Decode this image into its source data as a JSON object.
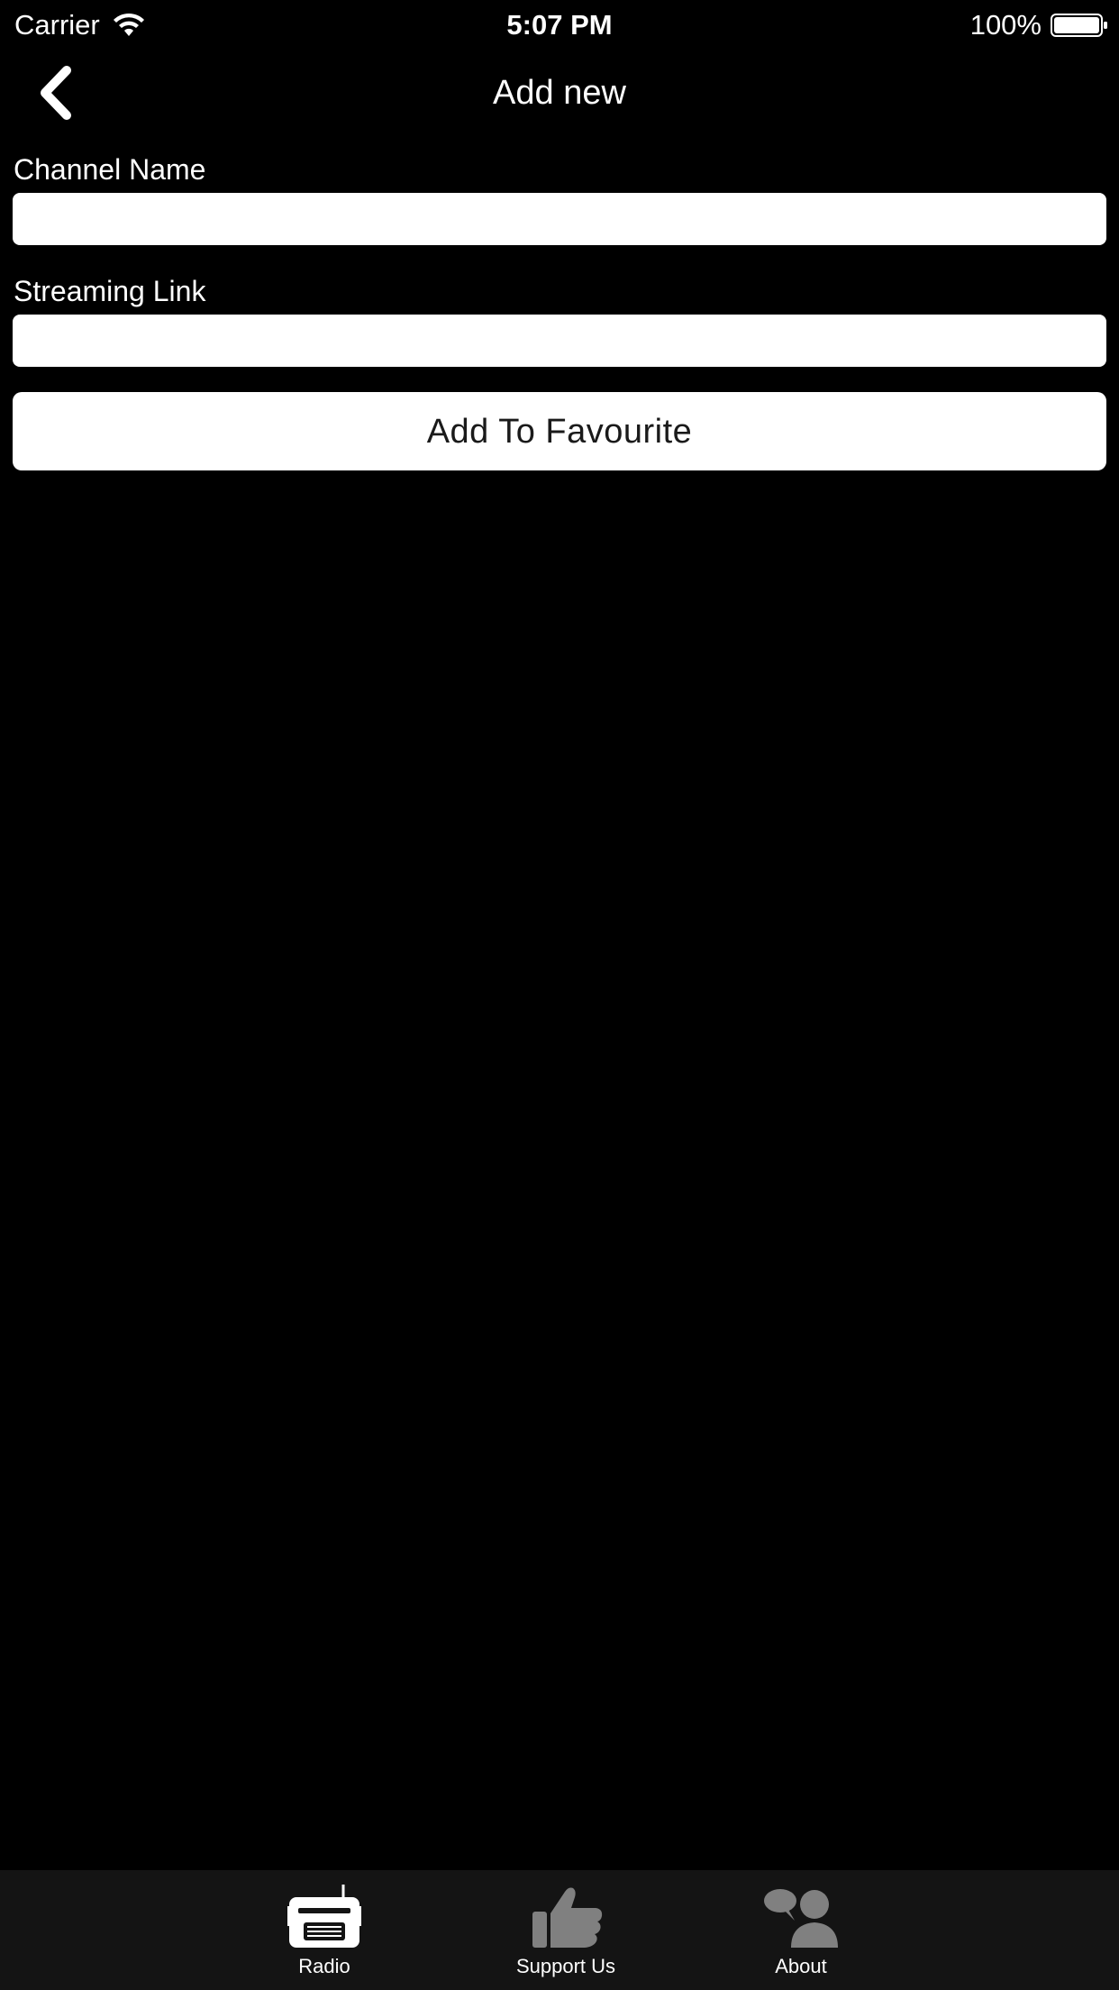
{
  "status_bar": {
    "carrier": "Carrier",
    "time": "5:07 PM",
    "battery": "100%"
  },
  "nav": {
    "title": "Add new",
    "back_icon": "chevron-left-icon"
  },
  "form": {
    "channel_name_label": "Channel Name",
    "channel_name_value": "",
    "streaming_link_label": "Streaming Link",
    "streaming_link_value": "",
    "submit_label": "Add To Favourite"
  },
  "tabs": [
    {
      "label": "Radio",
      "icon": "radio-icon",
      "color": "#ffffff"
    },
    {
      "label": "Support Us",
      "icon": "thumbs-up-icon",
      "color": "#808080"
    },
    {
      "label": "About",
      "icon": "chat-people-icon",
      "color": "#808080"
    }
  ],
  "colors": {
    "background": "#000000",
    "tab_bar": "#141414",
    "input_background": "#ffffff"
  }
}
